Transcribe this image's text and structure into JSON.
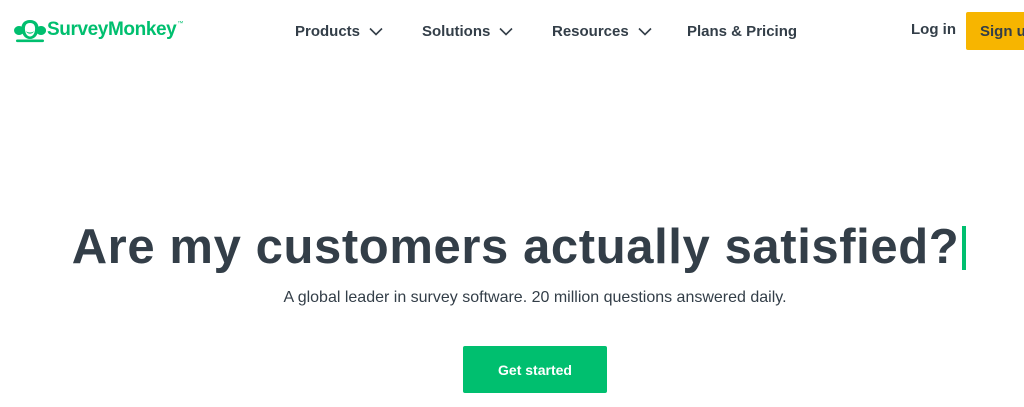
{
  "header": {
    "logo_text": "SurveyMonkey",
    "logo_tm": "™",
    "nav": {
      "products": "Products",
      "solutions": "Solutions",
      "resources": "Resources",
      "pricing": "Plans & Pricing"
    },
    "login_label": "Log in",
    "signup_label": "Sign up"
  },
  "hero": {
    "headline": "Are my customers actually satisfied?",
    "subheadline": "A global leader in survey software. 20 million questions answered daily.",
    "cta_label": "Get started"
  },
  "colors": {
    "brand_green": "#00bf6f",
    "signup_yellow": "#f7b500",
    "text_dark": "#333e48"
  },
  "icons": {
    "logo": "surveymonkey-logo-icon",
    "dropdown": "chevron-down-icon"
  }
}
